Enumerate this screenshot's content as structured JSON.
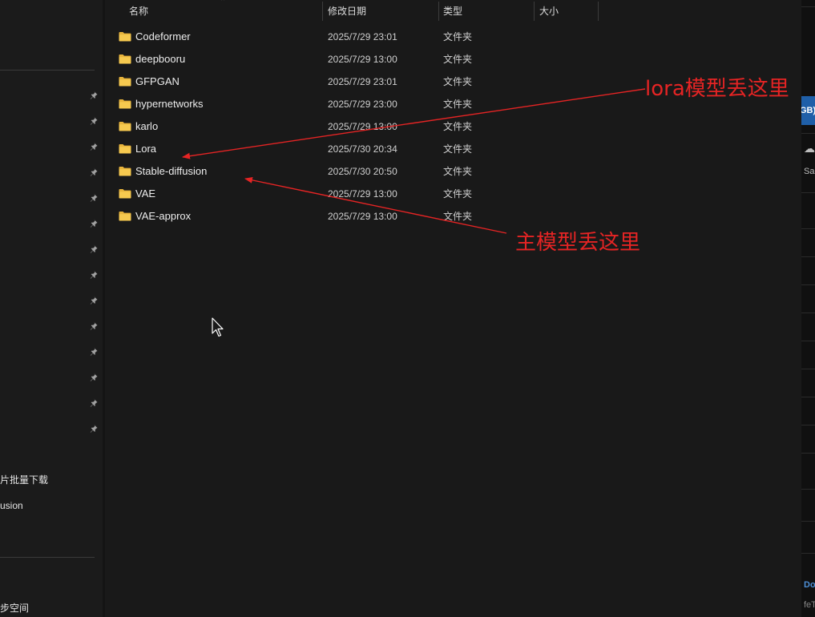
{
  "columns": {
    "name": "名称",
    "modified": "修改日期",
    "type": "类型",
    "size": "大小"
  },
  "files": [
    {
      "name": "Codeformer",
      "date": "2025/7/29 23:01",
      "type": "文件夹"
    },
    {
      "name": "deepbooru",
      "date": "2025/7/29 13:00",
      "type": "文件夹"
    },
    {
      "name": "GFPGAN",
      "date": "2025/7/29 23:01",
      "type": "文件夹"
    },
    {
      "name": "hypernetworks",
      "date": "2025/7/29 23:00",
      "type": "文件夹"
    },
    {
      "name": "karlo",
      "date": "2025/7/29 13:00",
      "type": "文件夹"
    },
    {
      "name": "Lora",
      "date": "2025/7/30 20:34",
      "type": "文件夹"
    },
    {
      "name": "Stable-diffusion",
      "date": "2025/7/30 20:50",
      "type": "文件夹"
    },
    {
      "name": "VAE",
      "date": "2025/7/29 13:00",
      "type": "文件夹"
    },
    {
      "name": "VAE-approx",
      "date": "2025/7/29 13:00",
      "type": "文件夹"
    }
  ],
  "nav": {
    "partial_items": [
      "片批量下载",
      "usion",
      "步空间"
    ]
  },
  "annotations": {
    "lora": "lora模型丢这里",
    "main": "主模型丢这里"
  },
  "right_window": {
    "badge": "GB)",
    "sa": "Sa",
    "do": "Do",
    "fe": "feT"
  },
  "colors": {
    "annotation_red": "#e52424",
    "folder_yellow": "#f3c04c",
    "background": "#191919"
  },
  "icons": [
    "folder-icon",
    "pin-icon",
    "sort-up-icon",
    "mouse-pointer-icon"
  ]
}
